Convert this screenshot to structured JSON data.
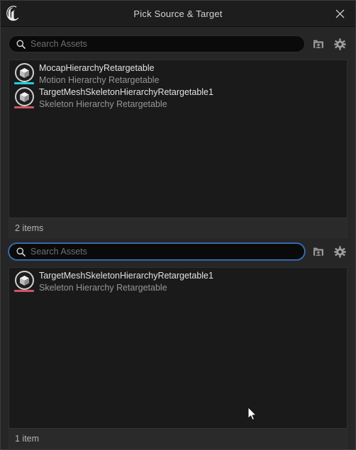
{
  "window": {
    "title": "Pick Source & Target",
    "logo_icon": "unreal-engine-logo",
    "close_icon": "close-icon"
  },
  "pickers": [
    {
      "id": "source",
      "search": {
        "placeholder": "Search Assets",
        "value": "",
        "focused": false,
        "search_icon": "search-icon",
        "folder_icon": "folder-icon",
        "settings_icon": "gear-icon"
      },
      "assets": [
        {
          "name": "MocapHierarchyRetargetable",
          "type": "Motion Hierarchy Retargetable",
          "icon": "cube-asset-icon",
          "accent": "#19d2dc"
        },
        {
          "name": "TargetMeshSkeletonHierarchyRetargetable1",
          "type": "Skeleton Hierarchy Retargetable",
          "icon": "cube-asset-icon",
          "accent": "#d2545f"
        }
      ],
      "footer": "2 items"
    },
    {
      "id": "target",
      "search": {
        "placeholder": "Search Assets",
        "value": "",
        "focused": true,
        "search_icon": "search-icon",
        "folder_icon": "folder-icon",
        "settings_icon": "gear-icon"
      },
      "assets": [
        {
          "name": "TargetMeshSkeletonHierarchyRetargetable1",
          "type": "Skeleton Hierarchy Retargetable",
          "icon": "cube-asset-icon",
          "accent": "#d2545f"
        }
      ],
      "footer": "1 item"
    }
  ],
  "cursor": {
    "icon": "mouse-pointer-icon"
  }
}
